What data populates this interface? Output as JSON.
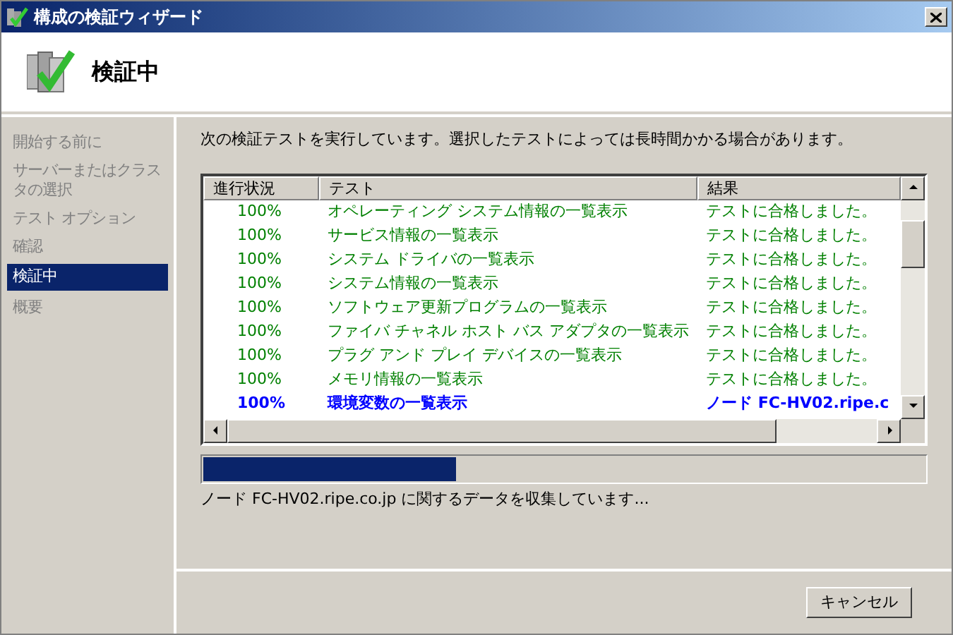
{
  "window": {
    "title": "構成の検証ウィザード"
  },
  "header": {
    "title": "検証中"
  },
  "sidebar": {
    "items": [
      {
        "label": "開始する前に",
        "selected": false
      },
      {
        "label": "サーバーまたはクラスタの選択",
        "selected": false
      },
      {
        "label": "テスト オプション",
        "selected": false
      },
      {
        "label": "確認",
        "selected": false
      },
      {
        "label": "検証中",
        "selected": true
      },
      {
        "label": "概要",
        "selected": false
      }
    ]
  },
  "intro": "次の検証テストを実行しています。選択したテストによっては長時間かかる場合があります。",
  "table": {
    "columns": [
      "進行状況",
      "テスト",
      "結果"
    ],
    "rows": [
      {
        "kind": "passed",
        "progress": "100%",
        "test": "オペレーティング システム情報の一覧表示",
        "result": "テストに合格しました。"
      },
      {
        "kind": "passed",
        "progress": "100%",
        "test": "サービス情報の一覧表示",
        "result": "テストに合格しました。"
      },
      {
        "kind": "passed",
        "progress": "100%",
        "test": "システム ドライバの一覧表示",
        "result": "テストに合格しました。"
      },
      {
        "kind": "passed",
        "progress": "100%",
        "test": "システム情報の一覧表示",
        "result": "テストに合格しました。"
      },
      {
        "kind": "passed",
        "progress": "100%",
        "test": "ソフトウェア更新プログラムの一覧表示",
        "result": "テストに合格しました。"
      },
      {
        "kind": "passed",
        "progress": "100%",
        "test": "ファイバ チャネル ホスト バス アダプタの一覧表示",
        "result": "テストに合格しました。"
      },
      {
        "kind": "passed",
        "progress": "100%",
        "test": "プラグ アンド プレイ デバイスの一覧表示",
        "result": "テストに合格しました。"
      },
      {
        "kind": "passed",
        "progress": "100%",
        "test": "メモリ情報の一覧表示",
        "result": "テストに合格しました。"
      },
      {
        "kind": "running",
        "progress": "100%",
        "test": "環境変数の一覧表示",
        "result": "ノード FC-HV02.ripe.c"
      }
    ]
  },
  "progress": {
    "level": 0.35,
    "status": "ノード FC-HV02.ripe.co.jp に関するデータを収集しています..."
  },
  "buttons": [
    "キャンセル"
  ]
}
